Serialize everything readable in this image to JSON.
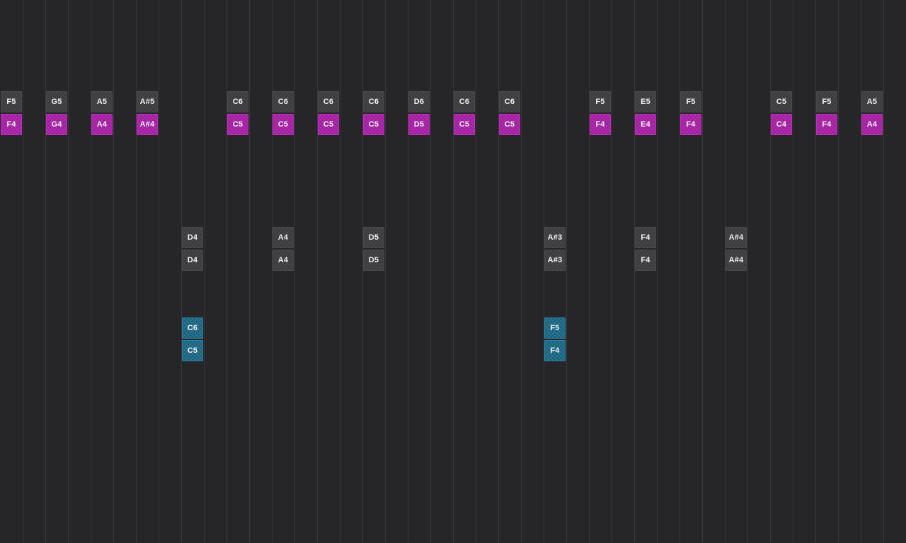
{
  "sequencer": {
    "colors": {
      "background": "#262628",
      "grid_line": "#38383b",
      "grey": "#3b3b3e",
      "magenta": "#a21aa0",
      "blue": "#17627f"
    },
    "column_count": 40,
    "row_count": 24,
    "notes": [
      {
        "label": "F5",
        "col": 0,
        "row": 4,
        "color": "grey"
      },
      {
        "label": "F4",
        "col": 0,
        "row": 5,
        "color": "magenta"
      },
      {
        "label": "G5",
        "col": 2,
        "row": 4,
        "color": "grey"
      },
      {
        "label": "G4",
        "col": 2,
        "row": 5,
        "color": "magenta"
      },
      {
        "label": "A5",
        "col": 4,
        "row": 4,
        "color": "grey"
      },
      {
        "label": "A4",
        "col": 4,
        "row": 5,
        "color": "magenta"
      },
      {
        "label": "A#5",
        "col": 6,
        "row": 4,
        "color": "grey"
      },
      {
        "label": "A#4",
        "col": 6,
        "row": 5,
        "color": "magenta"
      },
      {
        "label": "D4",
        "col": 8,
        "row": 10,
        "color": "grey"
      },
      {
        "label": "D4",
        "col": 8,
        "row": 11,
        "color": "grey"
      },
      {
        "label": "C6",
        "col": 8,
        "row": 14,
        "color": "blue"
      },
      {
        "label": "C5",
        "col": 8,
        "row": 15,
        "color": "blue"
      },
      {
        "label": "C6",
        "col": 10,
        "row": 4,
        "color": "grey"
      },
      {
        "label": "C5",
        "col": 10,
        "row": 5,
        "color": "magenta"
      },
      {
        "label": "C6",
        "col": 12,
        "row": 4,
        "color": "grey"
      },
      {
        "label": "C5",
        "col": 12,
        "row": 5,
        "color": "magenta"
      },
      {
        "label": "A4",
        "col": 12,
        "row": 10,
        "color": "grey"
      },
      {
        "label": "A4",
        "col": 12,
        "row": 11,
        "color": "grey"
      },
      {
        "label": "C6",
        "col": 14,
        "row": 4,
        "color": "grey"
      },
      {
        "label": "C5",
        "col": 14,
        "row": 5,
        "color": "magenta"
      },
      {
        "label": "C6",
        "col": 16,
        "row": 4,
        "color": "grey"
      },
      {
        "label": "C5",
        "col": 16,
        "row": 5,
        "color": "magenta"
      },
      {
        "label": "D5",
        "col": 16,
        "row": 10,
        "color": "grey"
      },
      {
        "label": "D5",
        "col": 16,
        "row": 11,
        "color": "grey"
      },
      {
        "label": "D6",
        "col": 18,
        "row": 4,
        "color": "grey"
      },
      {
        "label": "D5",
        "col": 18,
        "row": 5,
        "color": "magenta"
      },
      {
        "label": "C6",
        "col": 20,
        "row": 4,
        "color": "grey"
      },
      {
        "label": "C5",
        "col": 20,
        "row": 5,
        "color": "magenta"
      },
      {
        "label": "C6",
        "col": 22,
        "row": 4,
        "color": "grey"
      },
      {
        "label": "C5",
        "col": 22,
        "row": 5,
        "color": "magenta"
      },
      {
        "label": "A#3",
        "col": 24,
        "row": 10,
        "color": "grey"
      },
      {
        "label": "A#3",
        "col": 24,
        "row": 11,
        "color": "grey"
      },
      {
        "label": "F5",
        "col": 24,
        "row": 14,
        "color": "blue"
      },
      {
        "label": "F4",
        "col": 24,
        "row": 15,
        "color": "blue"
      },
      {
        "label": "F5",
        "col": 26,
        "row": 4,
        "color": "grey"
      },
      {
        "label": "F4",
        "col": 26,
        "row": 5,
        "color": "magenta"
      },
      {
        "label": "E5",
        "col": 28,
        "row": 4,
        "color": "grey"
      },
      {
        "label": "E4",
        "col": 28,
        "row": 5,
        "color": "magenta"
      },
      {
        "label": "F4",
        "col": 28,
        "row": 10,
        "color": "grey"
      },
      {
        "label": "F4",
        "col": 28,
        "row": 11,
        "color": "grey"
      },
      {
        "label": "F5",
        "col": 30,
        "row": 4,
        "color": "grey"
      },
      {
        "label": "F4",
        "col": 30,
        "row": 5,
        "color": "magenta"
      },
      {
        "label": "A#4",
        "col": 32,
        "row": 10,
        "color": "grey"
      },
      {
        "label": "A#4",
        "col": 32,
        "row": 11,
        "color": "grey"
      },
      {
        "label": "C5",
        "col": 34,
        "row": 4,
        "color": "grey"
      },
      {
        "label": "C4",
        "col": 34,
        "row": 5,
        "color": "magenta"
      },
      {
        "label": "F5",
        "col": 36,
        "row": 4,
        "color": "grey"
      },
      {
        "label": "F4",
        "col": 36,
        "row": 5,
        "color": "magenta"
      },
      {
        "label": "A5",
        "col": 38,
        "row": 4,
        "color": "grey"
      },
      {
        "label": "A4",
        "col": 38,
        "row": 5,
        "color": "magenta"
      }
    ]
  }
}
